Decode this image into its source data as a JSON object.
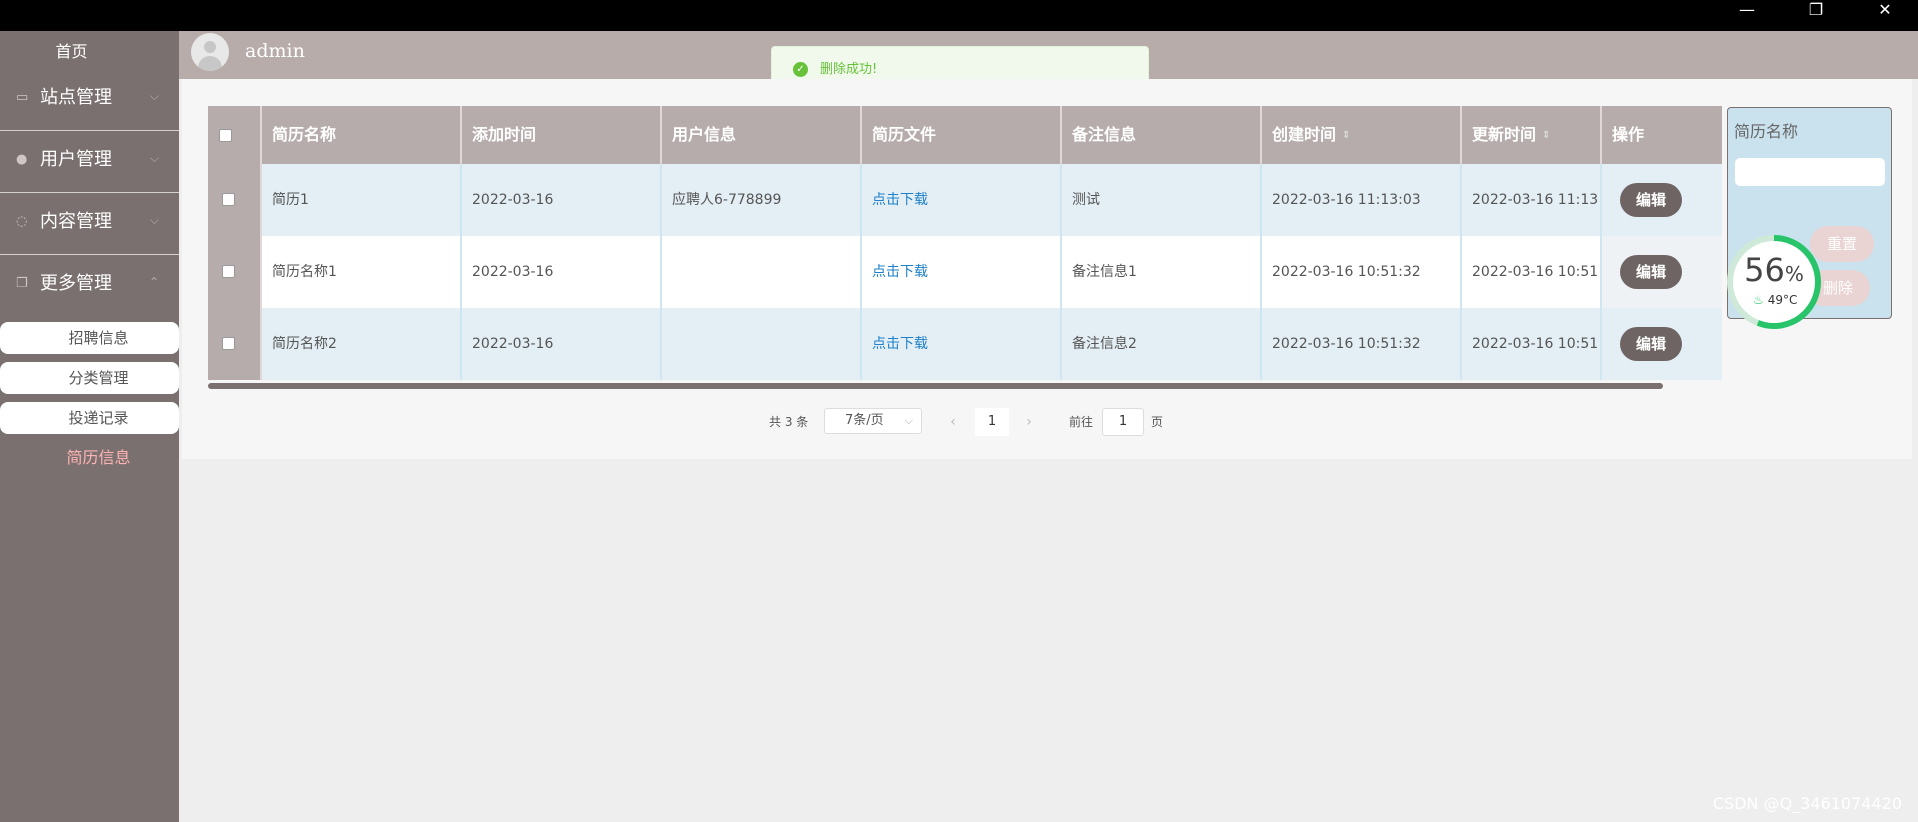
{
  "window": {
    "minimize": "—",
    "restore": "❐",
    "close": "✕"
  },
  "sidebar": {
    "home": "首页",
    "groups": [
      {
        "label": "站点管理",
        "icon": "monitor-icon"
      },
      {
        "label": "用户管理",
        "icon": "user-icon"
      },
      {
        "label": "内容管理",
        "icon": "chat-icon"
      },
      {
        "label": "更多管理",
        "icon": "copy-icon"
      }
    ],
    "sub_items": [
      "招聘信息",
      "分类管理",
      "投递记录"
    ],
    "active_item": "简历信息"
  },
  "header": {
    "username": "admin"
  },
  "toast": {
    "message": "删除成功!"
  },
  "table": {
    "columns": [
      "简历名称",
      "添加时间",
      "用户信息",
      "简历文件",
      "备注信息",
      "创建时间",
      "更新时间",
      "操作"
    ],
    "rows": [
      {
        "name": "简历1",
        "added": "2022-03-16",
        "user": "应聘人6-778899",
        "file": "点击下载",
        "remark": "测试",
        "created": "2022-03-16 11:13:03",
        "updated": "2022-03-16 11:13",
        "action": "编辑"
      },
      {
        "name": "简历名称1",
        "added": "2022-03-16",
        "user": "",
        "file": "点击下载",
        "remark": "备注信息1",
        "created": "2022-03-16 10:51:32",
        "updated": "2022-03-16 10:51",
        "action": "编辑"
      },
      {
        "name": "简历名称2",
        "added": "2022-03-16",
        "user": "",
        "file": "点击下载",
        "remark": "备注信息2",
        "created": "2022-03-16 10:51:32",
        "updated": "2022-03-16 10:51",
        "action": "编辑"
      }
    ]
  },
  "pagination": {
    "total": "共 3 条",
    "page_size": "7条/页",
    "current": "1",
    "goto_label": "前往",
    "goto_value": "1",
    "page_unit": "页"
  },
  "search_panel": {
    "label": "简历名称",
    "reset": "重置",
    "delete": "删除"
  },
  "gauge": {
    "percent": 56,
    "percent_text": "56",
    "percent_sign": "%",
    "temperature": "49°C"
  },
  "watermark": "CSDN @Q_3461074420",
  "colors": {
    "sidebar": "#7b7070",
    "header": "#b8acab",
    "accent_green": "#27c46a",
    "link": "#1e80c8",
    "active_pink": "#ffb3b3"
  }
}
